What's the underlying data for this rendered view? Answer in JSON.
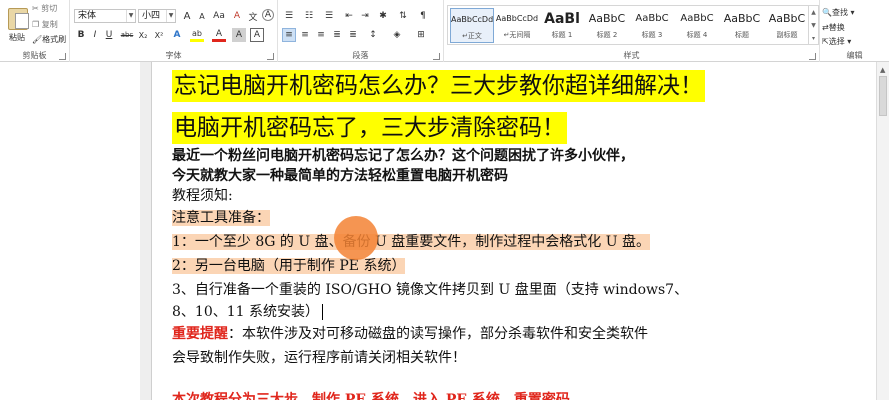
{
  "ribbon": {
    "clipboard": {
      "paste_label": "粘贴",
      "cut_label": "剪切",
      "copy_label": "复制",
      "format_painter_label": "格式刷",
      "group_label": "剪贴板"
    },
    "font": {
      "font_name": "宋体",
      "font_size": "小四",
      "group_label": "字体",
      "bold": "B",
      "italic": "I",
      "underline": "U",
      "strike": "abc",
      "subscript": "X₂",
      "superscript": "X²",
      "text_effect": "A",
      "highlight": "ab",
      "font_color": "A",
      "char_shade": "A",
      "char_border": "A",
      "grow": "A",
      "shrink": "A",
      "case": "Aa",
      "clear_format": "A",
      "phonetic": "文",
      "enclose": "A"
    },
    "paragraph": {
      "group_label": "段落"
    },
    "styles": {
      "group_label": "样式",
      "items": [
        {
          "preview": "AaBbCcDd",
          "name": "↵正文"
        },
        {
          "preview": "AaBbCcDd",
          "name": "↵无间隔"
        },
        {
          "preview": "AaBl",
          "name": "标题 1"
        },
        {
          "preview": "AaBbC",
          "name": "标题 2"
        },
        {
          "preview": "AaBbC",
          "name": "标题 3"
        },
        {
          "preview": "AaBbC",
          "name": "标题 4"
        },
        {
          "preview": "AaBbC",
          "name": "标题"
        },
        {
          "preview": "AaBbC",
          "name": "副标题"
        }
      ]
    },
    "editing": {
      "group_label": "编辑",
      "find": "查找",
      "replace": "替换",
      "select": "选择"
    }
  },
  "document": {
    "title1": "忘记电脑开机密码怎么办？三大步教你超详细解决！",
    "title2": "电脑开机密码忘了，三大步清除密码！",
    "para1_line1": "    最近一个粉丝问电脑开机密码忘记了怎么办？这个问题困扰了许多小伙伴，",
    "para1_line2": "今天就教大家一种最简单的方法轻松重置电脑开机密码",
    "notice": "教程须知:",
    "tools_heading": "注意工具准备：",
    "item1": "1：一个至少 8G 的 U 盘、备份 U 盘重要文件，制作过程中会格式化 U 盘。",
    "item2": "2：另一台电脑（用于制作 PE 系统）",
    "item3_line1": "3、自行准备一个重装的 ISO/GHO 镜像文件拷贝到 U 盘里面（支持 windows7、",
    "item3_line2": "    8、10、11 系统安装）",
    "warning_label": "重要提醒",
    "warning_line1": "：本软件涉及对可移动磁盘的读写操作，部分杀毒软件和安全类软件",
    "warning_line2": "会导致制作失败，运行程序前请关闭相关软件！",
    "partial_line": "本次教程分为三大步，制作 PE 系统，进入 PE 系统，重置密码"
  }
}
